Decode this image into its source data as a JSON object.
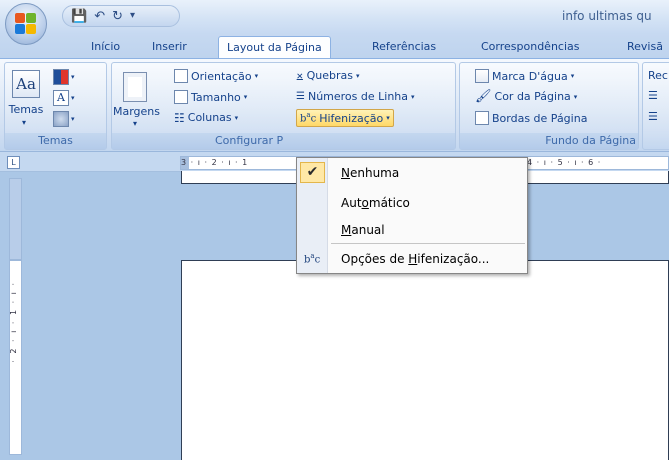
{
  "window": {
    "title": "info ultimas qu"
  },
  "quick_access": {
    "icons": [
      "save-icon",
      "undo-icon",
      "redo-icon",
      "customize-icon"
    ]
  },
  "tabs": [
    {
      "label": "Início"
    },
    {
      "label": "Inserir"
    },
    {
      "label": "Layout da Página",
      "active": true
    },
    {
      "label": "Referências"
    },
    {
      "label": "Correspondências"
    },
    {
      "label": "Revisã"
    }
  ],
  "ribbon": {
    "temas": {
      "big_button": "Temas",
      "group_label": "Temas"
    },
    "configurar": {
      "margens": "Margens",
      "orientacao": "Orientação",
      "tamanho": "Tamanho",
      "colunas": "Colunas",
      "quebras": "Quebras",
      "numeros_linha": "Números de Linha",
      "hifenizacao": "Hifenização",
      "group_label": "Configurar P"
    },
    "fundo": {
      "marca_dagua": "Marca D'água",
      "cor_pagina": "Cor da Página",
      "bordas_pagina": "Bordas de Página",
      "group_label": "Fundo da Página"
    },
    "recuo": {
      "label": "Rec"
    }
  },
  "ruler": {
    "corner": "L",
    "h_left": "3 · ı · 2 · ı · 1",
    "h_right": "4 · ı · 5 · ı · 6 ·",
    "v_text": "· 2 · ı · 1 · ı ·"
  },
  "hyphenation_menu": {
    "items": [
      {
        "pre": "",
        "ul": "N",
        "post": "enhuma",
        "checked": true
      },
      {
        "pre": "Aut",
        "ul": "o",
        "post": "mático",
        "checked": false
      },
      {
        "pre": "",
        "ul": "M",
        "post": "anual",
        "checked": false
      }
    ],
    "options": {
      "pre": "Opções de ",
      "ul": "H",
      "post": "ifenização..."
    }
  },
  "colors": {
    "ribbon_text": "#15428b",
    "highlight": "#ffd868"
  }
}
